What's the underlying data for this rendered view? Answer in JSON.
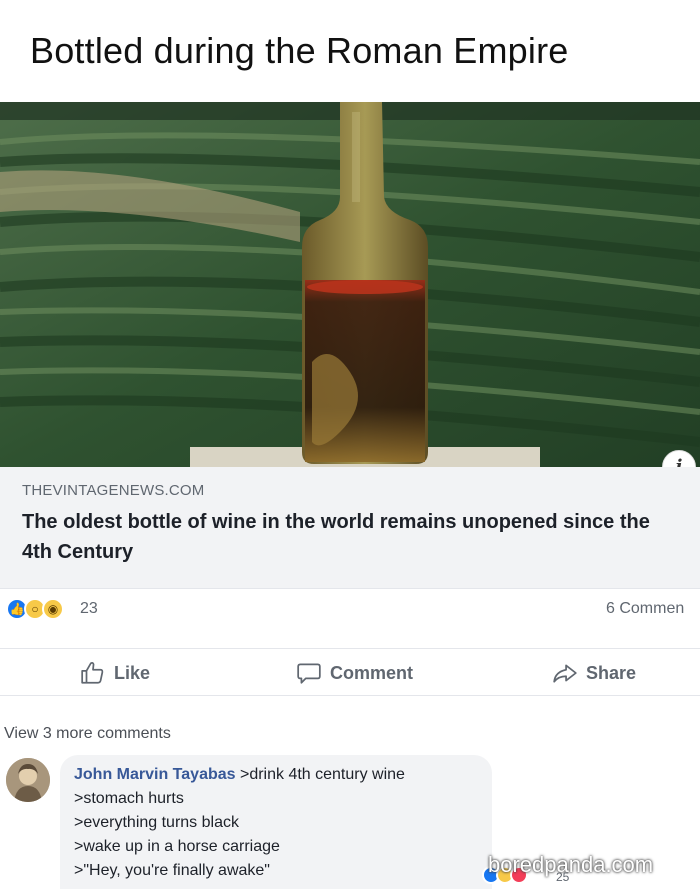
{
  "meme": {
    "title": "Bottled during the Roman Empire"
  },
  "post": {
    "link": {
      "domain": "THEVINTAGENEWS.COM",
      "headline": "The oldest bottle of wine in the world remains unopened since the 4th Century"
    },
    "info_icon": "info-icon",
    "reactions": {
      "icons": [
        "like-icon",
        "wow-icon",
        "haha-icon"
      ],
      "count": "23",
      "comments_count": "6 Commen"
    },
    "actions": {
      "like": "Like",
      "comment": "Comment",
      "share": "Share"
    },
    "view_more": "View 3 more comments",
    "comment": {
      "author": "John Marvin Tayabas",
      "first_line": " >drink 4th century wine",
      "lines": [
        ">stomach hurts",
        ">everything turns black",
        ">wake up in a horse carriage",
        ">\"Hey, you're finally awake\""
      ],
      "reaction_count": "25"
    }
  },
  "watermark": "boredpanda.com",
  "colors": {
    "brand_blue": "#1877f2",
    "author_link": "#385898",
    "muted_text": "#606770",
    "preview_bg": "#f2f3f5"
  }
}
